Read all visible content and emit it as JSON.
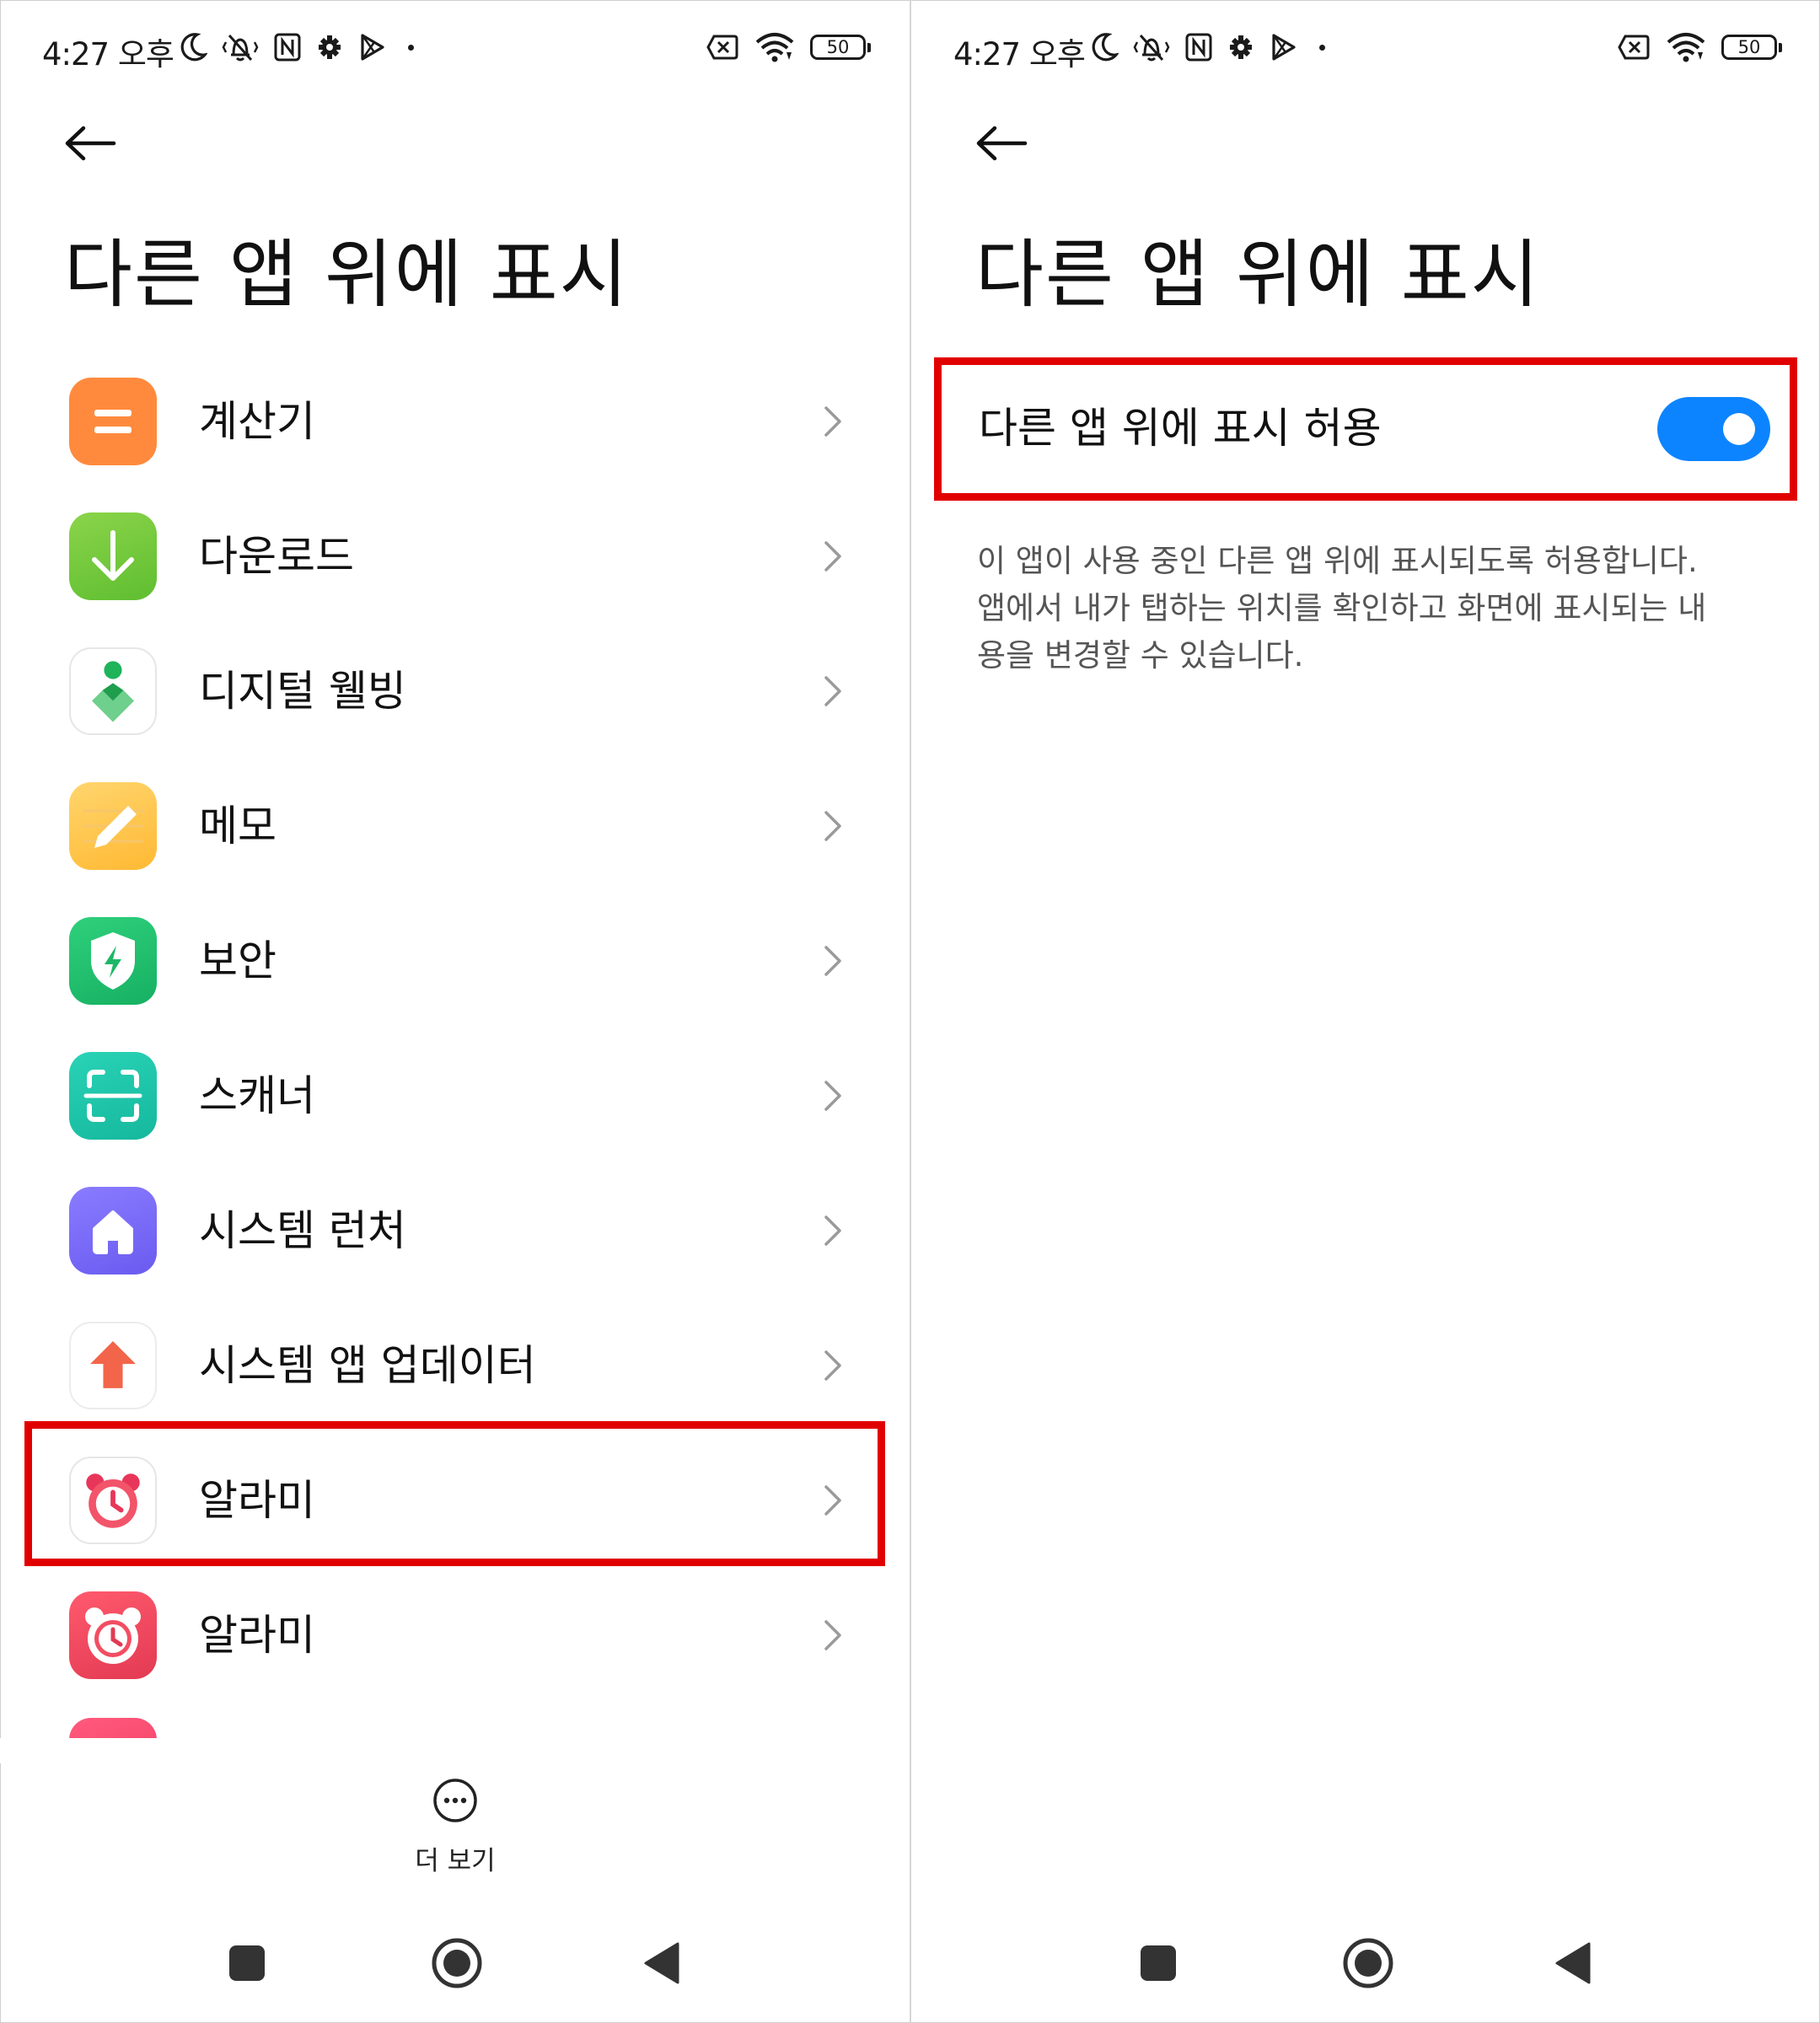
{
  "status_bar": {
    "time": "4:27 오후",
    "battery": "50"
  },
  "left": {
    "title": "다른 앱 위에 표시",
    "apps": [
      {
        "label": "계산기",
        "icon": "calculator-icon"
      },
      {
        "label": "다운로드",
        "icon": "download-icon"
      },
      {
        "label": "디지털 웰빙",
        "icon": "digital-wellbeing-icon"
      },
      {
        "label": "메모",
        "icon": "notes-icon"
      },
      {
        "label": "보안",
        "icon": "security-icon"
      },
      {
        "label": "스캐너",
        "icon": "scanner-icon"
      },
      {
        "label": "시스템 런처",
        "icon": "system-launcher-icon"
      },
      {
        "label": "시스템 앱 업데이터",
        "icon": "system-app-updater-icon"
      },
      {
        "label": "알라미",
        "icon": "alarmy-icon"
      },
      {
        "label": "알라미",
        "icon": "alarmy-icon"
      }
    ],
    "more_label": "더 보기"
  },
  "right": {
    "title": "다른 앱 위에 표시",
    "toggle_label": "다른 앱 위에 표시 허용",
    "toggle_on": true,
    "description_lines": [
      "이 앱이 사용 중인 다른 앱 위에 표시되도록 허용합니다.",
      "앱에서 내가 탭하는 위치를 확인하고 화면에 표시되는 내",
      "용을 변경할 수 있습니다."
    ]
  },
  "colors": {
    "highlight": "#e10000",
    "toggle": "#0d84ff"
  }
}
